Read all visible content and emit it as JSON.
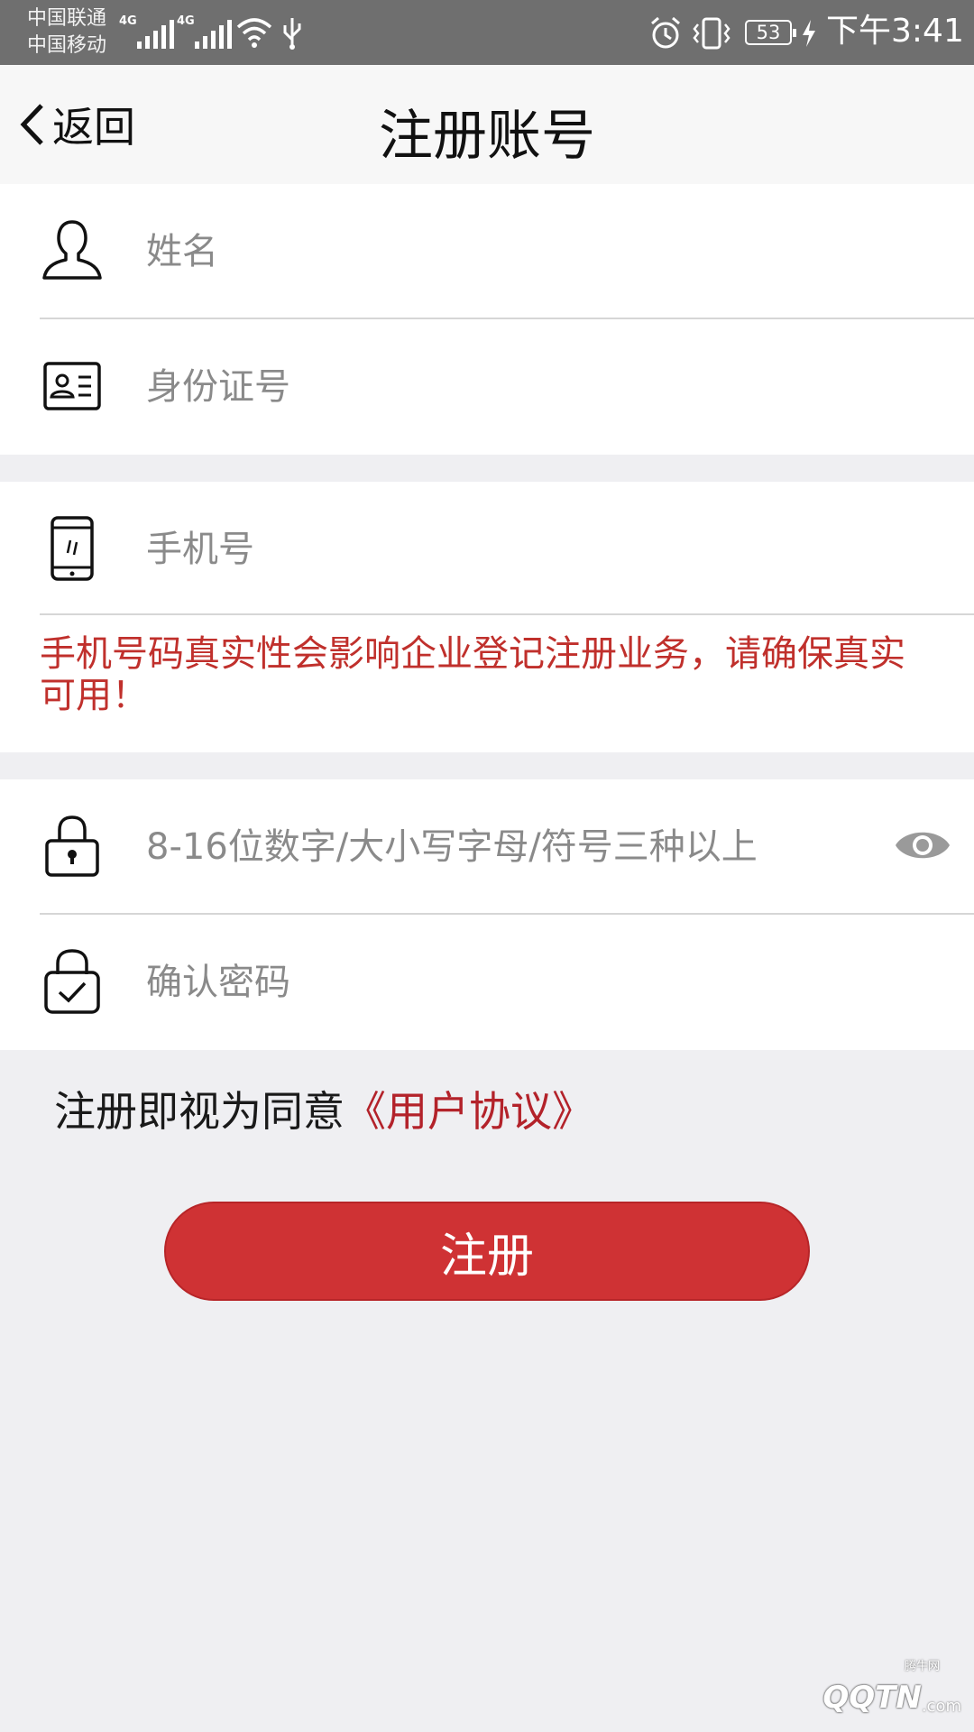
{
  "status_bar": {
    "carrier_1": "中国联通",
    "carrier_2": "中国移动",
    "network_1": "4G",
    "network_2": "4G",
    "battery": "53",
    "time": "下午3:41"
  },
  "nav": {
    "back_label": "返回",
    "title": "注册账号"
  },
  "form": {
    "name_placeholder": "姓名",
    "id_placeholder": "身份证号",
    "phone_placeholder": "手机号",
    "phone_warning": "手机号码真实性会影响企业登记注册业务，请确保真实可用！",
    "password_placeholder": "8-16位数字/大小写字母/符号三种以上",
    "confirm_placeholder": "确认密码"
  },
  "agreement": {
    "prefix": "注册即视为同意",
    "link": "《用户协议》"
  },
  "submit_label": "注册",
  "watermark": {
    "brand": "QQTN",
    "suffix": ".com",
    "cn": "腾牛网"
  },
  "colors": {
    "accent": "#cf3234",
    "warning_text": "#c0302c",
    "link": "#b3222a",
    "background": "#efeff2",
    "status_bar": "#6f6f6f"
  }
}
